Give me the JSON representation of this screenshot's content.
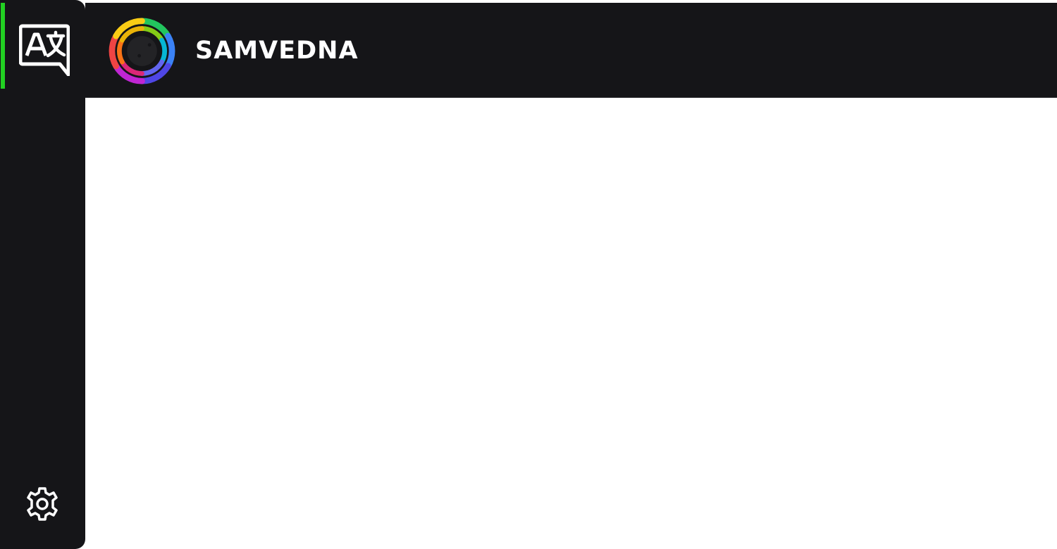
{
  "header": {
    "title": "SAMVEDNA",
    "logo_icon": "rainbow-swirl-logo"
  },
  "sidebar": {
    "items": [
      {
        "icon": "translate-icon",
        "active": true
      }
    ],
    "footer": {
      "icon": "gear-icon"
    }
  },
  "colors": {
    "background": "#151518",
    "active_indicator": "#22d122",
    "text": "#ffffff"
  }
}
